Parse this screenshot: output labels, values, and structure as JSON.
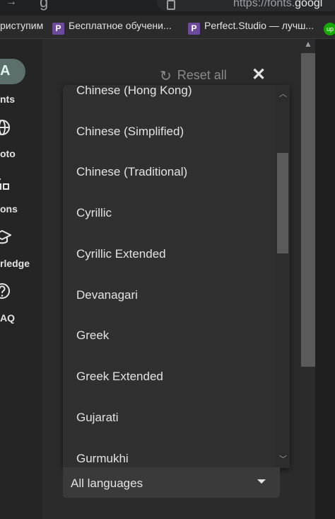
{
  "browser": {
    "url_prefix": "https://fonts.",
    "url_domain": "googl"
  },
  "bookmarks": [
    {
      "label": "риступим",
      "icon": "bookmark-icon"
    },
    {
      "label": "Бесплатное обучени...",
      "icon": "P"
    },
    {
      "label": "Perfect.Studio — лучш...",
      "icon": "P"
    },
    {
      "label": "",
      "icon": "up"
    }
  ],
  "rail": {
    "active_icon_glyph": "A",
    "items": [
      {
        "label": "nts",
        "icon": "fonts-icon"
      },
      {
        "label": "oto",
        "icon": "globe-icon"
      },
      {
        "label": "ons",
        "icon": "icons-icon"
      },
      {
        "label": "rledge",
        "icon": "knowledge-icon"
      },
      {
        "label": "AQ",
        "icon": "help-icon"
      }
    ]
  },
  "panel": {
    "reset_label": "Reset all",
    "close_glyph": "✕"
  },
  "dropdown": {
    "options": [
      "Chinese (Hong Kong)",
      "Chinese (Simplified)",
      "Chinese (Traditional)",
      "Cyrillic",
      "Cyrillic Extended",
      "Devanagari",
      "Greek",
      "Greek Extended",
      "Gujarati",
      "Gurmukhi"
    ],
    "selected_value": "All languages"
  },
  "colors": {
    "background": "#1f1f1f",
    "panel": "#2b2b2b",
    "dropdown": "#303030",
    "rail_active": "#5c6f6c",
    "text": "#e3e3e3",
    "muted_text": "#8a8a8a"
  }
}
